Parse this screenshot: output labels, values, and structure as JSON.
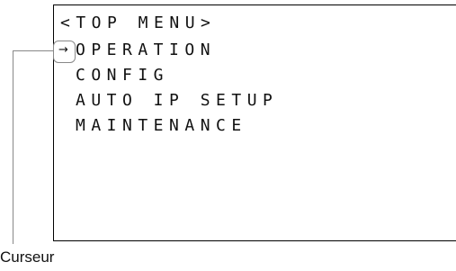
{
  "menu": {
    "title": "<TOP MENU>",
    "cursor_symbol": "→",
    "items": [
      {
        "label": "OPERATION"
      },
      {
        "label": "CONFIG"
      },
      {
        "label": "AUTO IP SETUP"
      },
      {
        "label": "MAINTENANCE"
      }
    ],
    "selected_index": 0
  },
  "callout": {
    "label": "Curseur"
  },
  "colors": {
    "screen_border": "#000000",
    "callout_line": "#888888",
    "text": "#111111"
  }
}
